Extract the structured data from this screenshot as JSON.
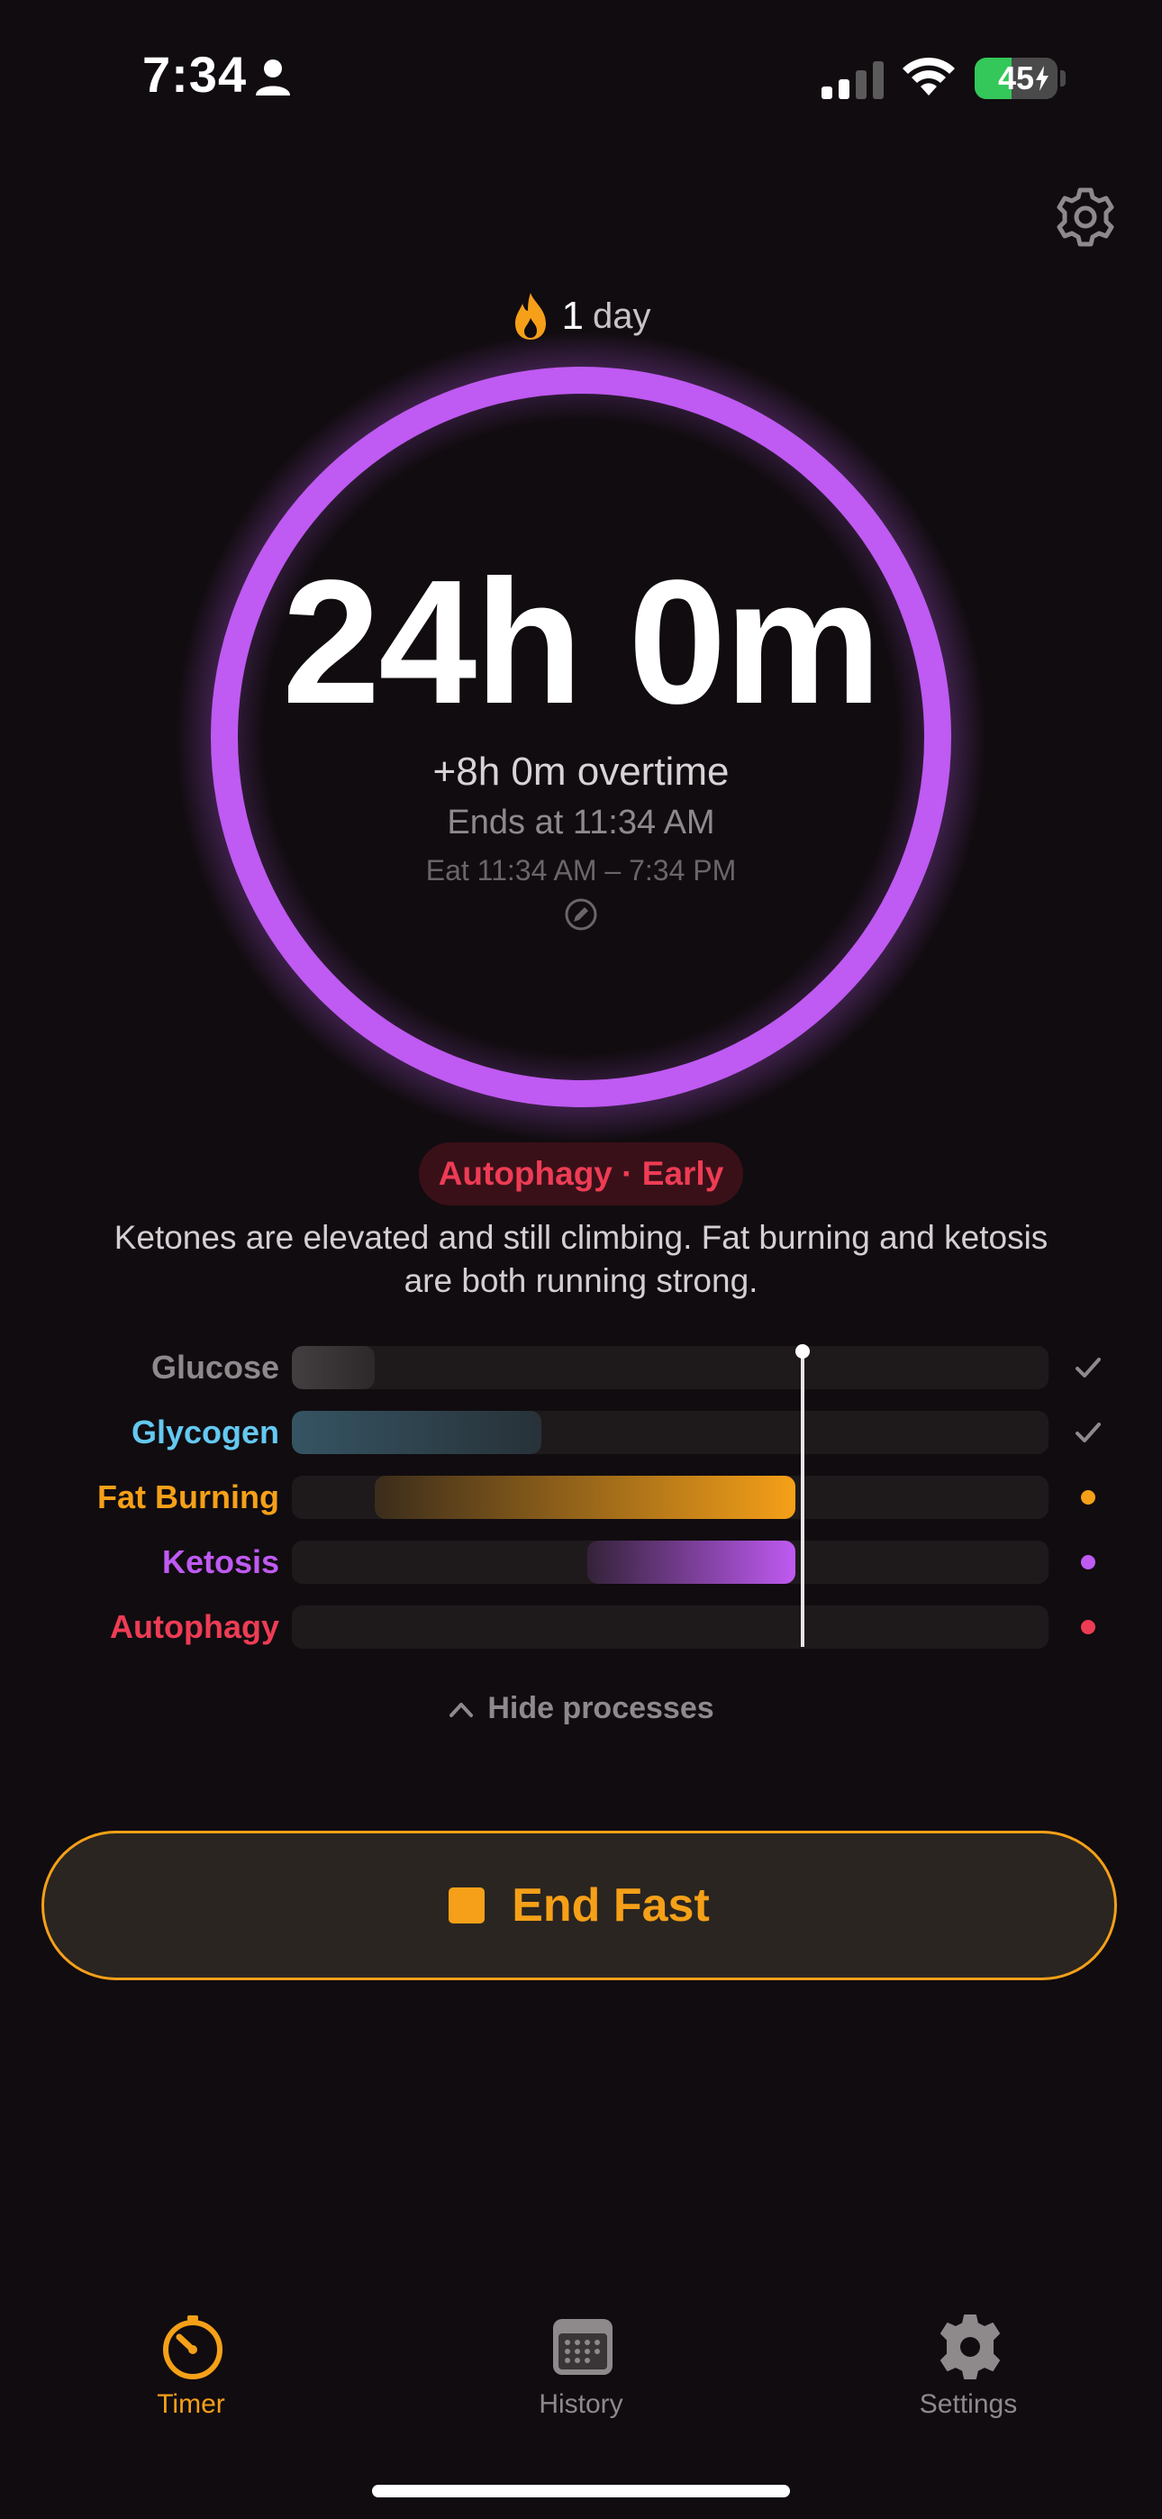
{
  "status_bar": {
    "time": "7:34",
    "battery_level": "45",
    "battery_fraction": 0.45
  },
  "streak": {
    "count": "1",
    "unit": "day"
  },
  "timer": {
    "elapsed": "24h 0m",
    "overtime": "+8h 0m overtime",
    "ends_at": "Ends at 11:34 AM",
    "eat_window": "Eat 11:34 AM – 7:34 PM",
    "progress": 1.0,
    "ring_color": "#bf5af2"
  },
  "phase": {
    "badge": "Autophagy · Early",
    "description": "Ketones are elevated and still climbing. Fat burning and ketosis are both running strong."
  },
  "processes": {
    "now_fraction": 0.675,
    "items": [
      {
        "label": "Glucose",
        "color": "#8e8a8c",
        "start": 0.0,
        "end": 0.11,
        "status": "done"
      },
      {
        "label": "Glycogen",
        "color": "#64c8f0",
        "start": 0.0,
        "end": 0.33,
        "status": "done"
      },
      {
        "label": "Fat Burning",
        "color": "#f5a018",
        "start": 0.11,
        "end": 0.665,
        "status": "active"
      },
      {
        "label": "Ketosis",
        "color": "#bf5af2",
        "start": 0.39,
        "end": 0.665,
        "status": "active"
      },
      {
        "label": "Autophagy",
        "color": "#ee3c55",
        "start": 0.0,
        "end": 0.0,
        "status": "active"
      }
    ],
    "toggle_label": "Hide processes"
  },
  "actions": {
    "end_fast_label": "End Fast",
    "accent": "#f5a018"
  },
  "tabs": [
    {
      "label": "Timer",
      "icon": "timer-icon",
      "active": true
    },
    {
      "label": "History",
      "icon": "calendar-icon",
      "active": false
    },
    {
      "label": "Settings",
      "icon": "gear-icon",
      "active": false
    }
  ]
}
